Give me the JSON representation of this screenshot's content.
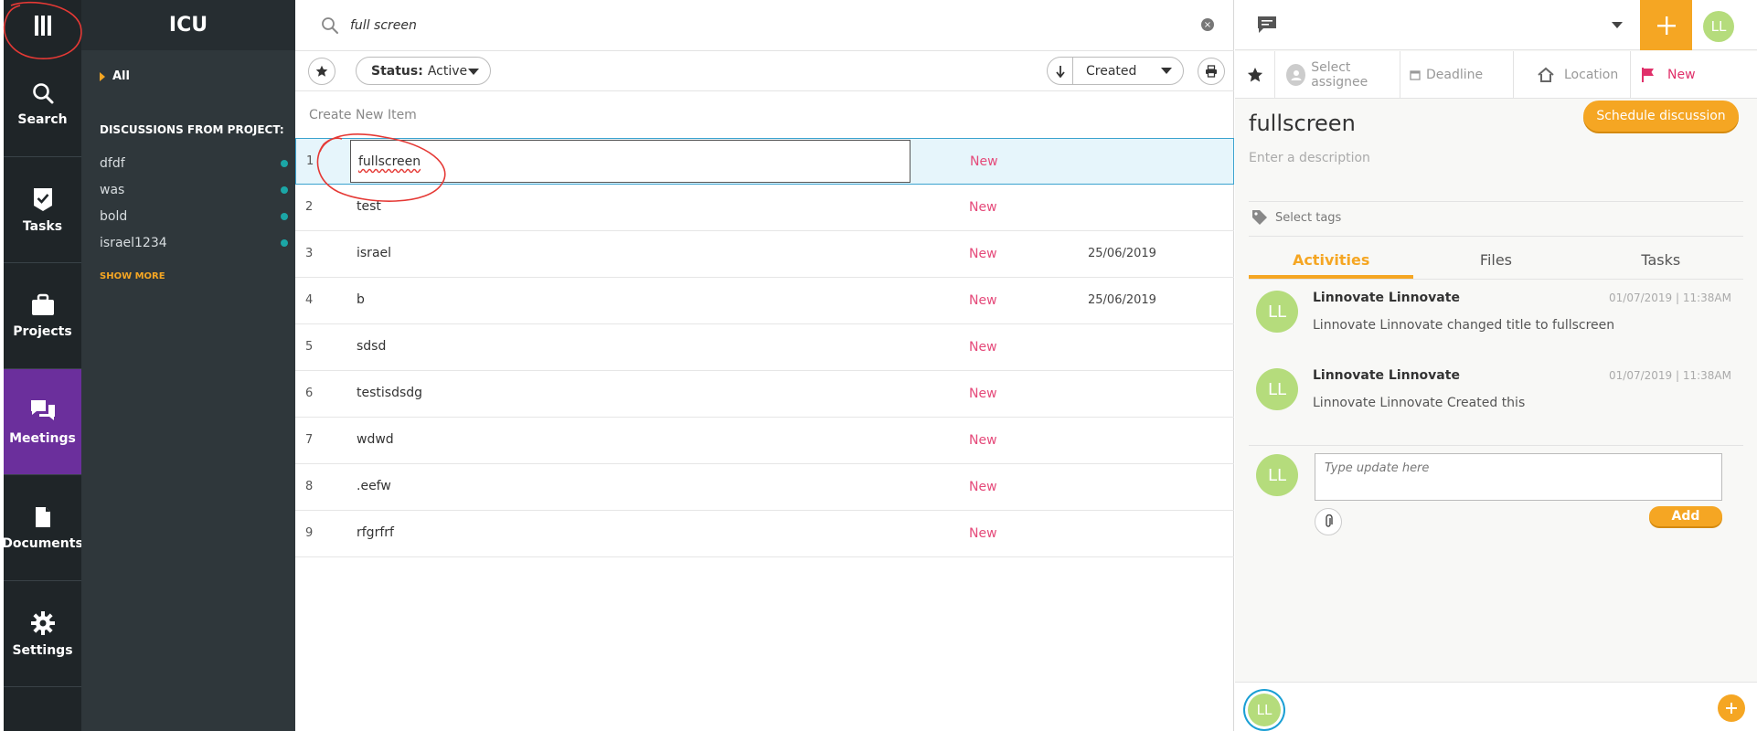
{
  "nav": {
    "items": [
      {
        "label": "Search",
        "icon": "search-icon"
      },
      {
        "label": "Tasks",
        "icon": "check-badge-icon"
      },
      {
        "label": "Projects",
        "icon": "briefcase-icon"
      },
      {
        "label": "Meetings",
        "icon": "chat-bubbles-icon"
      },
      {
        "label": "Documents",
        "icon": "document-icon"
      },
      {
        "label": "Settings",
        "icon": "gear-icon"
      }
    ],
    "active": "Meetings"
  },
  "project_sidebar": {
    "title": "ICU",
    "all_label": "All",
    "section_header": "DISCUSSIONS FROM PROJECT:",
    "discussions": [
      "dfdf",
      "was",
      "bold",
      "israel1234"
    ],
    "show_more": "SHOW MORE"
  },
  "list": {
    "search_value": "full screen",
    "status_label": "Status:",
    "status_value": "Active",
    "sort_value": "Created",
    "create_new": "Create New Item",
    "rows": [
      {
        "num": "1",
        "title": "fullscreen",
        "status": "New",
        "date": ""
      },
      {
        "num": "2",
        "title": "test",
        "status": "New",
        "date": ""
      },
      {
        "num": "3",
        "title": "israel",
        "status": "New",
        "date": "25/06/2019"
      },
      {
        "num": "4",
        "title": "b",
        "status": "New",
        "date": "25/06/2019"
      },
      {
        "num": "5",
        "title": "sdsd",
        "status": "New",
        "date": ""
      },
      {
        "num": "6",
        "title": "testisdsdg",
        "status": "New",
        "date": ""
      },
      {
        "num": "7",
        "title": "wdwd",
        "status": "New",
        "date": ""
      },
      {
        "num": "8",
        "title": ".eefw",
        "status": "New",
        "date": ""
      },
      {
        "num": "9",
        "title": "rfgrfrf",
        "status": "New",
        "date": ""
      }
    ]
  },
  "detail": {
    "user_initials": "LL",
    "assignee": "Select assignee",
    "deadline": "Deadline",
    "location": "Location",
    "status": "New",
    "title": "fullscreen",
    "schedule_button": "Schedule discussion",
    "description_placeholder": "Enter a description",
    "tags_placeholder": "Select tags",
    "tabs": [
      "Activities",
      "Files",
      "Tasks"
    ],
    "activities": [
      {
        "author": "Linnovate Linnovate",
        "time": "01/07/2019 | 11:38AM",
        "text": "Linnovate Linnovate changed title to fullscreen"
      },
      {
        "author": "Linnovate Linnovate",
        "time": "01/07/2019 | 11:38AM",
        "text": "Linnovate Linnovate Created this"
      }
    ],
    "update_placeholder": "Type update here",
    "add_button": "Add"
  },
  "colors": {
    "accent": "#f5a623",
    "nav_bg": "#1f2528",
    "sidebar_bg": "#2f373b",
    "active_nav": "#6b2f9c",
    "status_new": "#e54a7a",
    "selected_row": "#e6f5fb",
    "avatar": "#b5dc7c"
  }
}
